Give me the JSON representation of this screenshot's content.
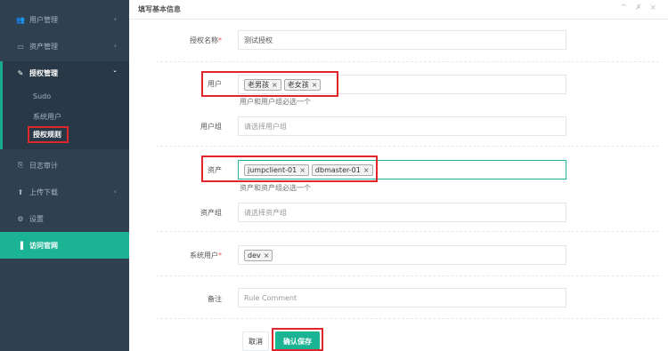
{
  "sidebar": {
    "items": [
      {
        "label": "用户管理",
        "icon": "users-icon",
        "glyph": "👥",
        "chevron": "‹"
      },
      {
        "label": "资产管理",
        "icon": "inbox-icon",
        "glyph": "▭",
        "chevron": "‹"
      },
      {
        "label": "授权管理",
        "icon": "edit-icon",
        "glyph": "✎",
        "chevron": "ˇ"
      },
      {
        "label": "日志审计",
        "icon": "copy-icon",
        "glyph": "⎘"
      },
      {
        "label": "上传下载",
        "icon": "upload-icon",
        "glyph": "⬆",
        "chevron": "‹"
      },
      {
        "label": "设置",
        "icon": "gears-icon",
        "glyph": "⚙"
      },
      {
        "label": "访问官网",
        "icon": "book-icon",
        "glyph": "▐"
      }
    ],
    "submenu": [
      {
        "label": "Sudo"
      },
      {
        "label": "系统用户"
      },
      {
        "label": "授权规则"
      }
    ]
  },
  "panel": {
    "title": "填写基本信息",
    "tools": "^ ✗ ×"
  },
  "form": {
    "name": {
      "label": "授权名称",
      "required": "*",
      "value": "测试授权"
    },
    "users": {
      "label": "用户",
      "tags": [
        "老男孩",
        "老女孩"
      ],
      "help": "用户和用户组必选一个"
    },
    "user_group": {
      "label": "用户组",
      "placeholder": "请选择用户组"
    },
    "assets": {
      "label": "资产",
      "tags": [
        "jumpclient-01",
        "dbmaster-01"
      ],
      "help": "资产和资产组必选一个"
    },
    "asset_group": {
      "label": "资产组",
      "placeholder": "请选择资产组"
    },
    "system_user": {
      "label": "系统用户",
      "required": "*",
      "tags": [
        "dev"
      ]
    },
    "comment": {
      "label": "备注",
      "placeholder": "Rule Comment"
    }
  },
  "buttons": {
    "cancel": "取消",
    "save": "确认保存"
  },
  "tag_remove": "×",
  "colors": {
    "sidebar": "#2f4050",
    "accent": "#1ab394",
    "highlight_box": "#e0262b"
  }
}
